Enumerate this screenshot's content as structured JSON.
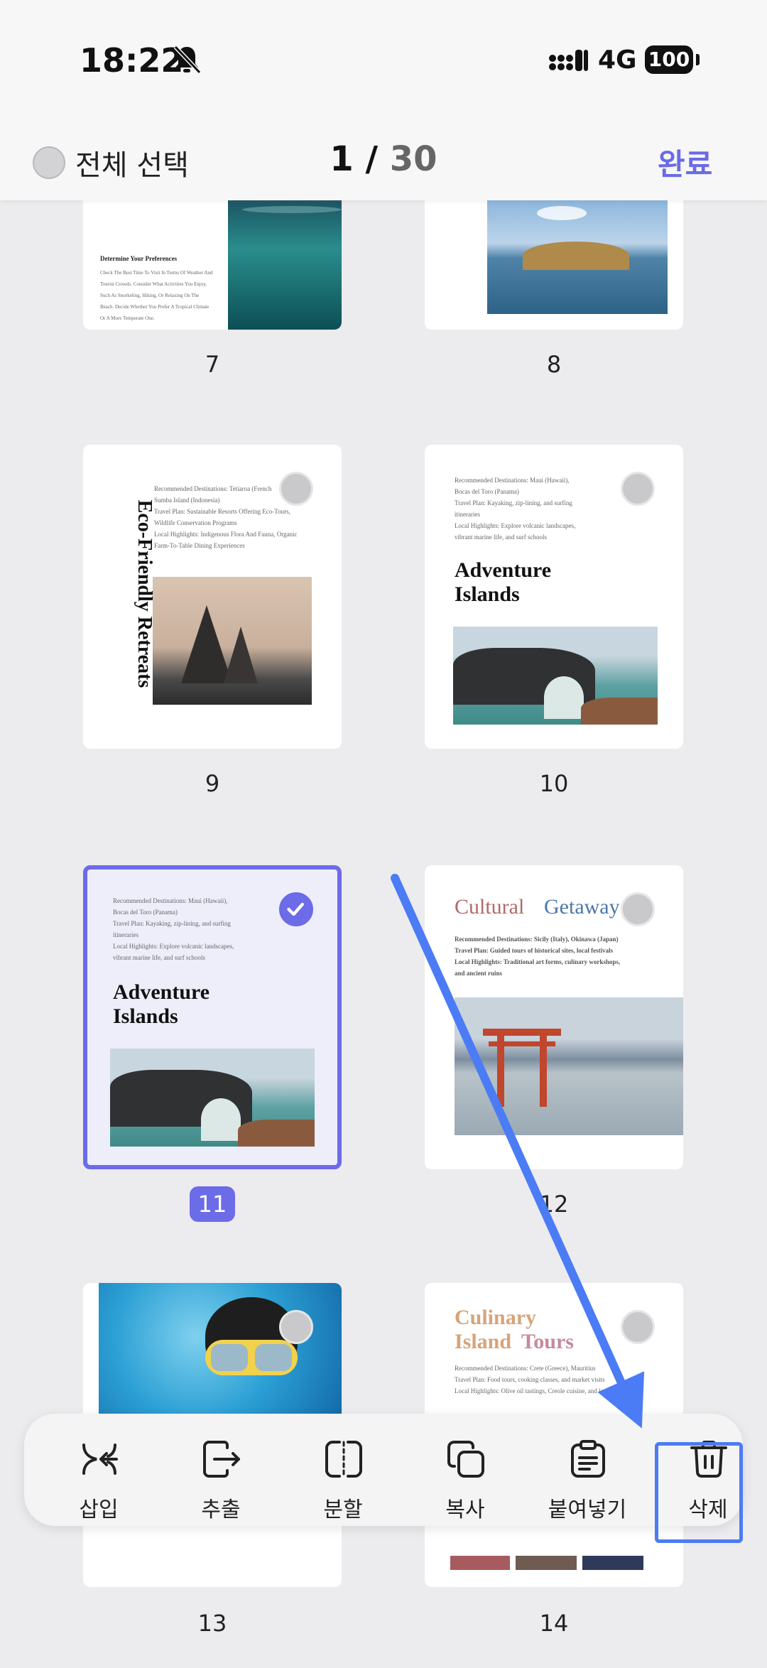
{
  "status_bar": {
    "time": "18:22",
    "network": "4G",
    "battery": "100"
  },
  "header": {
    "select_all_label": "전체 선택",
    "current_page": "1",
    "separator": "/",
    "total_pages": "30",
    "done_label": "완료"
  },
  "pages": {
    "p7": {
      "number": "7",
      "heading": "Determine Your Preferences",
      "body": "Check The Best Time To Visit In Terms Of Weather And Tourist Crowds. Consider What Activities You Enjoy, Such As Snorkeling, Hiking, Or Relaxing On The Beach. Decide Whether You Prefer A Tropical Climate Or A More Temperate One."
    },
    "p8": {
      "number": "8"
    },
    "p9": {
      "number": "9",
      "vertical_title": "Eco-Friendly Retreats",
      "line1": "Recommended Destinations: Tetiaroa (French",
      "line2": "Sumba Island (Indonesia)",
      "line3": "Travel Plan: Sustainable Resorts Offering Eco-Tours,",
      "line4": "Wildlife Conservation Programs",
      "line5": "Local Highlights: Indigenous Flora And Fauna, Organic",
      "line6": "Farm-To-Table Dining Experiences"
    },
    "p10": {
      "number": "10",
      "line1": "Recommended Destinations: Maui (Hawaii),",
      "line2": "Bocas del Toro (Panama)",
      "line3": "Travel Plan: Kayaking, zip-lining, and surfing",
      "line4": "itineraries",
      "line5": "Local Highlights: Explore volcanic landscapes,",
      "line6": "vibrant marine life, and surf schools",
      "title1": "Adventure",
      "title2": "Islands"
    },
    "p11": {
      "number": "11",
      "line1": "Recommended Destinations: Maui (Hawaii),",
      "line2": "Bocas del Toro (Panama)",
      "line3": "Travel Plan: Kayaking, zip-lining, and surfing",
      "line4": "itineraries",
      "line5": "Local Highlights: Explore volcanic landscapes,",
      "line6": "vibrant marine life, and surf schools",
      "title1": "Adventure",
      "title2": "Islands"
    },
    "p12": {
      "number": "12",
      "title_a": "Cultural",
      "title_b": "Getaway",
      "line1": "Recommended Destinations: Sicily (Italy), Okinawa (Japan)",
      "line2": "Travel Plan: Guided tours of historical sites, local festivals",
      "line3": "Local Highlights: Traditional art forms, culinary workshops,",
      "line4": "and ancient ruins"
    },
    "p13": {
      "number": "13"
    },
    "p14": {
      "number": "14",
      "title1": "Culinary",
      "title2a": "Island",
      "title2b": "Tours",
      "line1": "Recommended Destinations: Crete (Greece), Mauritius",
      "line2": "Travel Plan: Food tours, cooking classes, and market visits",
      "line3": "Local Highlights: Olive oil tastings, Creole cuisine, and local specialties"
    }
  },
  "toolbar": {
    "insert": "삽입",
    "extract": "추출",
    "split": "분할",
    "copy": "복사",
    "paste": "붙여넣기",
    "delete": "삭제"
  },
  "colors": {
    "accent": "#6c6be8",
    "annotation": "#4b7cf5"
  }
}
